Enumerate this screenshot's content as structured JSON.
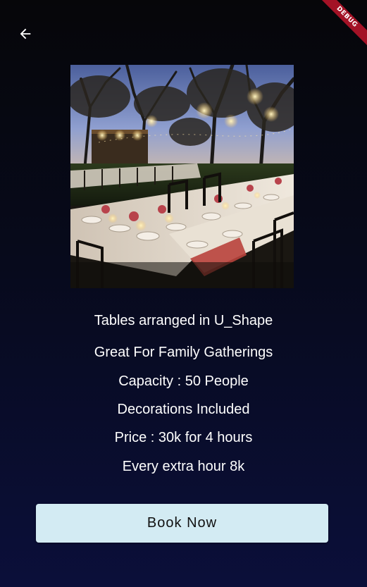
{
  "app_bar": {
    "back_icon": "arrow-back-icon",
    "debug_label": "DEBUG"
  },
  "venue": {
    "image": "outdoor-evening-banquet-tables-photo",
    "details": [
      "Tables arranged in U_Shape",
      "Great For Family Gatherings",
      "Capacity : 50 People",
      "Decorations Included",
      "Price : 30k for 4 hours",
      "Every extra hour 8k"
    ]
  },
  "actions": {
    "book_label": "Book Now"
  },
  "colors": {
    "background_top": "#060609",
    "background_bottom": "#0b0f3a",
    "button_background": "#d3ebf3",
    "button_text": "#111111",
    "debug_ribbon": "#a31226"
  }
}
